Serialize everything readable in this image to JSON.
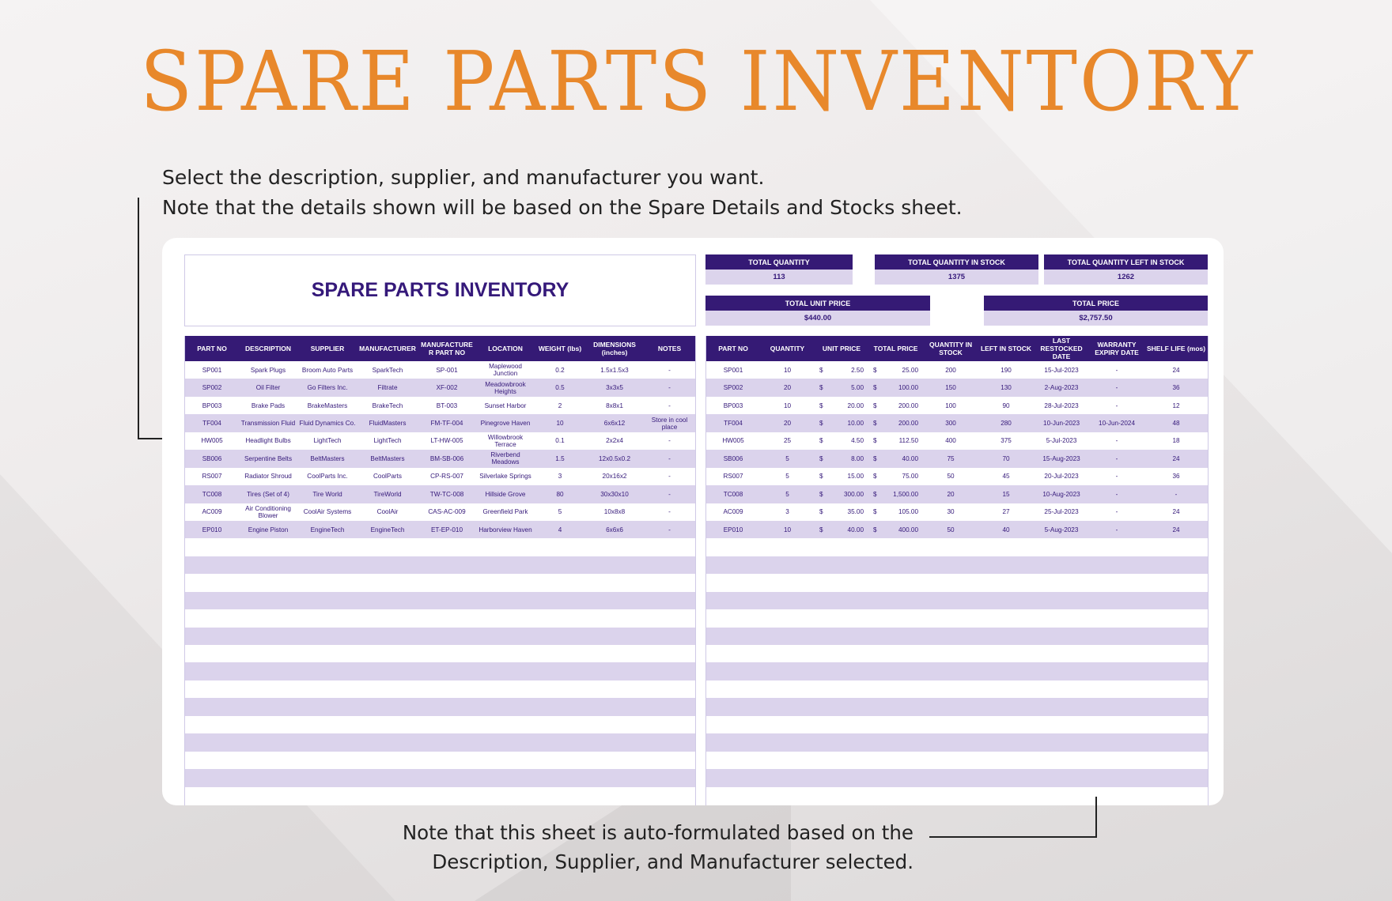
{
  "page": {
    "title": "SPARE PARTS INVENTORY",
    "instructions": [
      "Select the description, supplier, and manufacturer you want.",
      "Note that the details shown will be based on the Spare Details and Stocks sheet."
    ],
    "bottom_note": [
      "Note that this sheet is auto-formulated based on the",
      "Description, Supplier, and Manufacturer selected."
    ]
  },
  "colors": {
    "title_orange": "#e8882b",
    "header_purple": "#351a75",
    "row_alt_lavender": "#dbd3ec",
    "text_purple": "#35197a"
  },
  "sheet": {
    "title": "SPARE PARTS INVENTORY",
    "summary": {
      "total_quantity": {
        "label": "TOTAL QUANTITY",
        "value": "113"
      },
      "total_quantity_in_stock": {
        "label": "TOTAL QUANTITY IN STOCK",
        "value": "1375"
      },
      "total_quantity_left_in_stock": {
        "label": "TOTAL QUANTITY LEFT IN STOCK",
        "value": "1262"
      },
      "total_unit_price": {
        "label": "TOTAL UNIT PRICE",
        "value": "$440.00"
      },
      "total_price": {
        "label": "TOTAL PRICE",
        "value": "$2,757.50"
      }
    },
    "details_table": {
      "columns": [
        "PART NO",
        "DESCRIPTION",
        "SUPPLIER",
        "MANUFACTURER",
        "MANUFACTURE R PART NO",
        "LOCATION",
        "WEIGHT (lbs)",
        "DIMENSIONS (inches)",
        "NOTES"
      ],
      "rows": [
        [
          "SP001",
          "Spark Plugs",
          "Broom Auto Parts",
          "SparkTech",
          "SP-001",
          "Maplewood Junction",
          "0.2",
          "1.5x1.5x3",
          "-"
        ],
        [
          "SP002",
          "Oil Filter",
          "Go Filters Inc.",
          "Filtrate",
          "XF-002",
          "Meadowbrook Heights",
          "0.5",
          "3x3x5",
          "-"
        ],
        [
          "BP003",
          "Brake Pads",
          "BrakeMasters",
          "BrakeTech",
          "BT-003",
          "Sunset Harbor",
          "2",
          "8x8x1",
          "-"
        ],
        [
          "TF004",
          "Transmission Fluid",
          "Fluid Dynamics Co.",
          "FluidMasters",
          "FM-TF-004",
          "Pinegrove Haven",
          "10",
          "6x6x12",
          "Store in cool place"
        ],
        [
          "HW005",
          "Headlight Bulbs",
          "LightTech",
          "LightTech",
          "LT-HW-005",
          "Willowbrook Terrace",
          "0.1",
          "2x2x4",
          "-"
        ],
        [
          "SB006",
          "Serpentine Belts",
          "BeltMasters",
          "BeltMasters",
          "BM-SB-006",
          "Riverbend Meadows",
          "1.5",
          "12x0.5x0.2",
          "-"
        ],
        [
          "RS007",
          "Radiator Shroud",
          "CoolParts Inc.",
          "CoolParts",
          "CP-RS-007",
          "Silverlake Springs",
          "3",
          "20x16x2",
          "-"
        ],
        [
          "TC008",
          "Tires (Set of 4)",
          "Tire World",
          "TireWorld",
          "TW-TC-008",
          "Hillside Grove",
          "80",
          "30x30x10",
          "-"
        ],
        [
          "AC009",
          "Air Conditioning Blower",
          "CoolAir Systems",
          "CoolAir",
          "CAS-AC-009",
          "Greenfield Park",
          "5",
          "10x8x8",
          "-"
        ],
        [
          "EP010",
          "Engine Piston",
          "EngineTech",
          "EngineTech",
          "ET-EP-010",
          "Harborview Haven",
          "4",
          "6x6x6",
          "-"
        ]
      ],
      "empty_rows": 15
    },
    "stock_table": {
      "columns": [
        "PART NO",
        "QUANTITY",
        "UNIT PRICE",
        "TOTAL PRICE",
        "QUANTITY IN STOCK",
        "LEFT IN STOCK",
        "LAST RESTOCKED DATE",
        "WARRANTY EXPIRY DATE",
        "SHELF LIFE (mos)"
      ],
      "currency_symbol": "$",
      "rows": [
        [
          "SP001",
          "10",
          "2.50",
          "25.00",
          "200",
          "190",
          "15-Jul-2023",
          "-",
          "24"
        ],
        [
          "SP002",
          "20",
          "5.00",
          "100.00",
          "150",
          "130",
          "2-Aug-2023",
          "-",
          "36"
        ],
        [
          "BP003",
          "10",
          "20.00",
          "200.00",
          "100",
          "90",
          "28-Jul-2023",
          "-",
          "12"
        ],
        [
          "TF004",
          "20",
          "10.00",
          "200.00",
          "300",
          "280",
          "10-Jun-2023",
          "10-Jun-2024",
          "48"
        ],
        [
          "HW005",
          "25",
          "4.50",
          "112.50",
          "400",
          "375",
          "5-Jul-2023",
          "-",
          "18"
        ],
        [
          "SB006",
          "5",
          "8.00",
          "40.00",
          "75",
          "70",
          "15-Aug-2023",
          "-",
          "24"
        ],
        [
          "RS007",
          "5",
          "15.00",
          "75.00",
          "50",
          "45",
          "20-Jul-2023",
          "-",
          "36"
        ],
        [
          "TC008",
          "5",
          "300.00",
          "1,500.00",
          "20",
          "15",
          "10-Aug-2023",
          "-",
          "-"
        ],
        [
          "AC009",
          "3",
          "35.00",
          "105.00",
          "30",
          "27",
          "25-Jul-2023",
          "-",
          "24"
        ],
        [
          "EP010",
          "10",
          "40.00",
          "400.00",
          "50",
          "40",
          "5-Aug-2023",
          "-",
          "24"
        ]
      ],
      "empty_rows": 15
    }
  }
}
